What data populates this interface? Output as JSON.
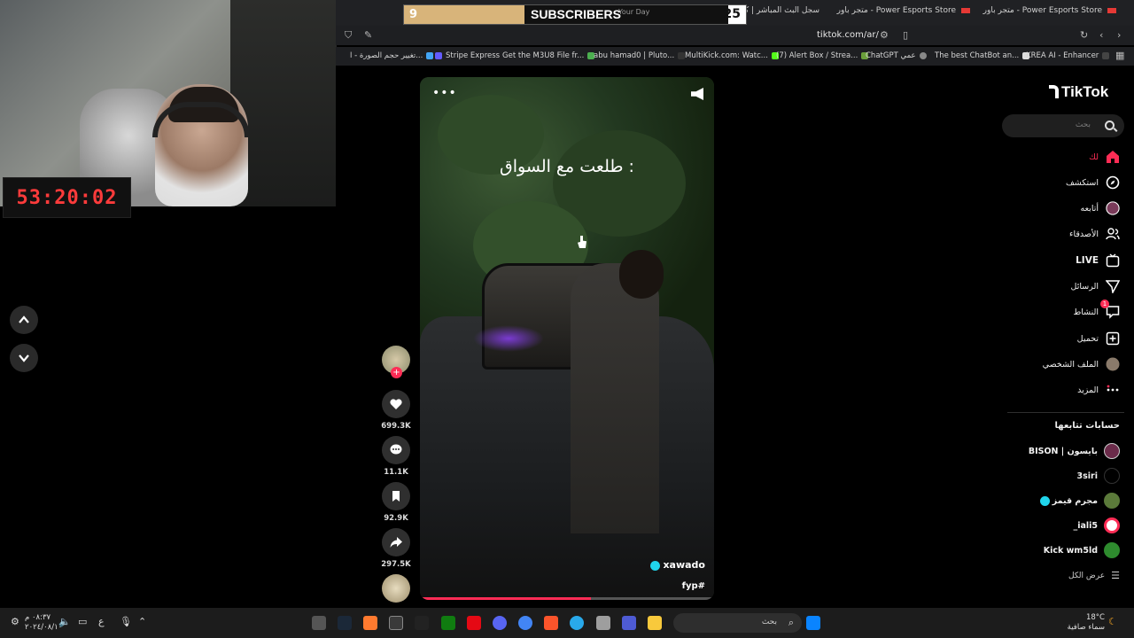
{
  "webcam": {
    "timer": "53:20:02"
  },
  "subscriber_widget": {
    "left_count": "9",
    "title": "SUBSCRIBERS",
    "ghost_text": "Your Day",
    "right_count": "25"
  },
  "browser": {
    "tabs": [
      "متجر باور - Power Esports Store",
      "متجر باور - Power Esports Store",
      "سجل البث المباشر | كرت"
    ],
    "url": "tiktok.com/ar/",
    "bookmarks": [
      "تغيير حجم الصورة - ا...",
      "Stripe Express",
      "Get the M3U8 File fr...",
      "abu hamad0 | Pluto...",
      "MultiKick.com: Watc...",
      "(7) Alert Box / Strea...",
      "ChatGPT عمي",
      "The best ChatBot an...",
      "KREA AI - Enhancer"
    ]
  },
  "video": {
    "caption": "طلعت مع السواق :",
    "username": "xawado",
    "hashtag": "fyp#",
    "progress": 0.58
  },
  "actions": {
    "likes": "699.3K",
    "comments": "11.1K",
    "saves": "92.9K",
    "shares": "297.5K"
  },
  "sidebar": {
    "logo": "TikTok",
    "search_placeholder": "بحث",
    "nav": [
      {
        "label": "لك",
        "icon": "home-icon"
      },
      {
        "label": "استكشف",
        "icon": "compass-icon"
      },
      {
        "label": "أتابعه",
        "icon": "following-icon"
      },
      {
        "label": "الأصدقاء",
        "icon": "friends-icon"
      },
      {
        "label": "LIVE",
        "icon": "live-icon"
      },
      {
        "label": "الرسائل",
        "icon": "messages-icon"
      },
      {
        "label": "النشاط",
        "icon": "activity-icon"
      },
      {
        "label": "تحميل",
        "icon": "upload-icon"
      },
      {
        "label": "الملف الشخصي",
        "icon": "profile-icon"
      },
      {
        "label": "المزيد",
        "icon": "more-icon"
      }
    ],
    "activity_badge": "1",
    "following_title": "حسابات تتابعها",
    "following": [
      "BISON | بايسون",
      "3siri",
      "مجرم قيمز",
      "_iali5",
      "Kick wm5ld"
    ],
    "see_all": "عرض الكل"
  },
  "taskbar": {
    "time": "٠٨:٣٧ م",
    "date": "٢٠٢٤/٠٨/١٠",
    "search": "بحث",
    "temp": "18°C",
    "weather": "سماء صافية",
    "lang": "ع"
  }
}
